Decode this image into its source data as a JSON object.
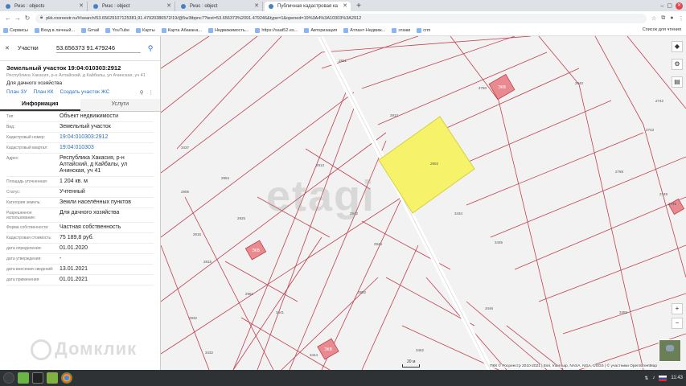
{
  "browser": {
    "tabs": [
      {
        "label": "Риэс : objects",
        "active": false
      },
      {
        "label": "Риэс : object",
        "active": false
      },
      {
        "label": "Риэс : object",
        "active": false
      },
      {
        "label": "Публичная кадастровая ка",
        "active": true
      }
    ],
    "url": "pkk.rosreestr.ru/#/search/53.65629107125381,91.47920386572/19/@5w3tbpnc7?text=53.656373%2091.479246&type=1&opened=19%3A4%3A10303%3A2912",
    "bookmarks": [
      "Сервисы",
      "Вход в личный...",
      "Gmail",
      "YouTube",
      "Карты",
      "Карта Абакана...",
      "Недвижимость...",
      "https://saat52.es...",
      "Авторизация",
      "Атлант-Недвиж...",
      "этажи",
      "crm"
    ],
    "bookmarks_right": "Список для чтения"
  },
  "panel": {
    "search_type": "Участки",
    "search_value": "53.656373 91.479246",
    "title": "Земельный участок 19:04:010303:2912",
    "address_hint": "Республика Хакасия, р-н Алтайский, д Кайбалы, ул Ачинская, уч 41",
    "use": "Для дачного хозяйства",
    "links": [
      "План ЗУ",
      "План КК",
      "Создать участок ЖС"
    ],
    "tab_info": "Информация",
    "tab_services": "Услуги",
    "props": [
      {
        "k": "Тип:",
        "v": "Объект недвижимости",
        "link": false
      },
      {
        "k": "Вид:",
        "v": "Земельный участок",
        "link": false
      },
      {
        "k": "Кадастровый номер:",
        "v": "19:04:010303:2912",
        "link": true
      },
      {
        "k": "Кадастровый квартал:",
        "v": "19:04:010303",
        "link": true
      },
      {
        "k": "Адрес:",
        "v": "Республика Хакасия, р-н Алтайский, д Кайбалы, ул Ачинская, уч 41",
        "link": false
      },
      {
        "k": "Площадь уточненная:",
        "v": "1 204 кв. м",
        "link": false
      },
      {
        "k": "Статус:",
        "v": "Учтенный",
        "link": false
      },
      {
        "k": "Категория земель:",
        "v": "Земли населённых пунктов",
        "link": false
      },
      {
        "k": "Разрешенное использование:",
        "v": "Для дачного хозяйства",
        "link": false
      },
      {
        "k": "Форма собственности:",
        "v": "Частная собственность",
        "link": false
      },
      {
        "k": "Кадастровая стоимость:",
        "v": "75 189,8 руб.",
        "link": false
      },
      {
        "k": "дата определения:",
        "v": "01.01.2020",
        "link": false
      },
      {
        "k": "дата утверждения:",
        "v": "-",
        "link": false
      },
      {
        "k": "дата внесения сведений:",
        "v": "13.01.2021",
        "link": false
      },
      {
        "k": "дата применения:",
        "v": "01.01.2021",
        "link": false
      }
    ],
    "watermark": "Домклик"
  },
  "map": {
    "watermark": "etagi",
    "highlight_color": "#f6f36a",
    "parcel_line_color": "#c0414f",
    "attribution": "ПКК © Росреестр 2010-2021 | Esri, Intermap, NASA, NGA, USGS | © участники OpenStreetMap",
    "scale": "20 м",
    "labels": [
      "2911",
      "2912",
      "2902",
      "2913",
      "2940",
      "2742",
      "2743",
      "2745",
      "2749",
      "2750",
      "2768",
      "3434",
      "3435",
      "3437",
      "2894",
      "2905",
      "2916",
      "2925",
      "2942",
      "2943",
      "2952",
      "2961",
      "2815",
      "2932",
      "3432",
      "3441",
      "3444",
      "3446",
      "3455",
      "3462"
    ],
    "buildings": [
      "ЭКВ",
      "ЭКВ",
      "ЭКВ"
    ]
  },
  "taskbar": {
    "time": "11:43"
  }
}
